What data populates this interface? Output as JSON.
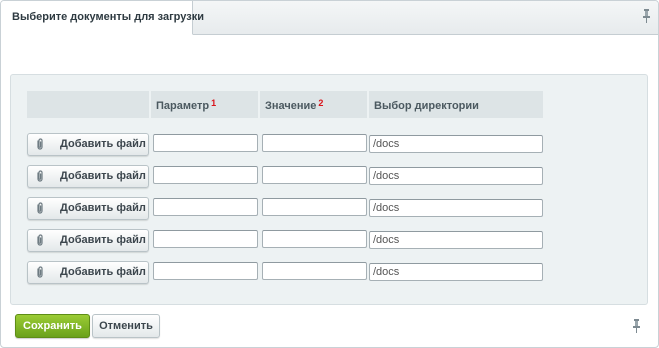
{
  "window": {
    "tab_title": "Выберите документы для загрузки"
  },
  "table": {
    "columns": [
      {
        "label": "",
        "footnote": ""
      },
      {
        "label": "Параметр",
        "footnote": "1"
      },
      {
        "label": "Значение",
        "footnote": "2"
      },
      {
        "label": "Выбор директории",
        "footnote": ""
      }
    ],
    "rows": [
      {
        "add_label": "Добавить файл",
        "param": "",
        "value": "",
        "directory": "/docs"
      },
      {
        "add_label": "Добавить файл",
        "param": "",
        "value": "",
        "directory": "/docs"
      },
      {
        "add_label": "Добавить файл",
        "param": "",
        "value": "",
        "directory": "/docs"
      },
      {
        "add_label": "Добавить файл",
        "param": "",
        "value": "",
        "directory": "/docs"
      },
      {
        "add_label": "Добавить файл",
        "param": "",
        "value": "",
        "directory": "/docs"
      }
    ]
  },
  "footer": {
    "save_label": "Сохранить",
    "cancel_label": "Отменить"
  },
  "colors": {
    "save_button": "#7cb225",
    "footnote": "#d9141b",
    "panel_bg": "#edf2f3"
  },
  "icons": {
    "pin": "pin-icon",
    "attach": "paperclip-icon"
  }
}
